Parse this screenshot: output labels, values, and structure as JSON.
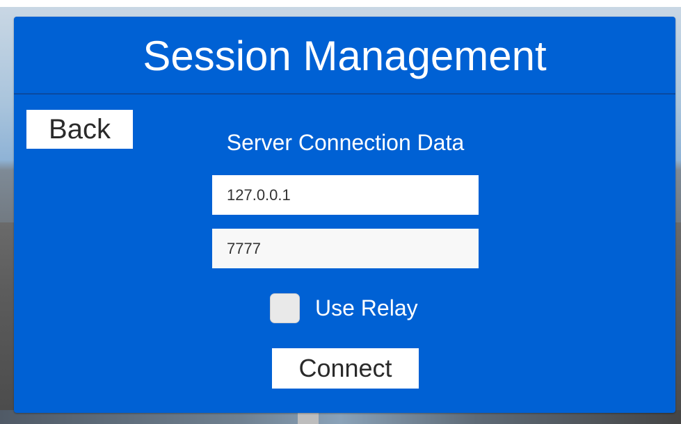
{
  "panel": {
    "title": "Session Management",
    "back_label": "Back",
    "subtitle": "Server Connection Data",
    "ip_input": {
      "value": "127.0.0.1"
    },
    "port_input": {
      "value": "7777"
    },
    "use_relay": {
      "label": "Use Relay",
      "checked": false
    },
    "connect_label": "Connect"
  },
  "colors": {
    "panel_background": "#0061d4",
    "panel_text": "#ffffff",
    "control_background": "#ffffff",
    "control_text": "#2a2a2a"
  }
}
